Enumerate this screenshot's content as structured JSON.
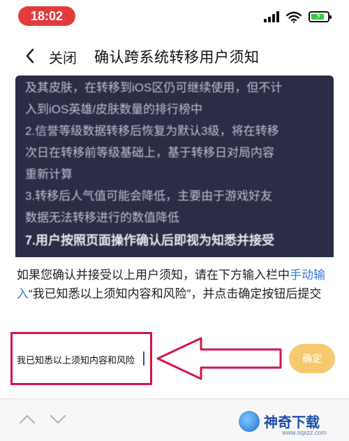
{
  "status_bar": {
    "time": "18:02",
    "time_pill_color": "#e23b3b",
    "icons": [
      "signal-icon",
      "wifi-icon",
      "battery-charging-icon"
    ]
  },
  "nav": {
    "back_icon": "chevron-left-icon",
    "close_label": "关闭",
    "title": "确认跨系统转移用户须知"
  },
  "notice": {
    "lines": [
      "及其皮肤，在转移到iOS区仍可继续使用，但不计",
      "入到iOS英雄/皮肤数量的排行榜中",
      "2.信誉等级数据转移后恢复为默认3级，将在转移",
      "次日在转移前等级基础上，基于转移日对局内容",
      "重新计算",
      "3.转移后人气值可能会降低，主要由于游戏好友",
      "数据无法转移进行的数值降低"
    ],
    "heading": "7.用户按照页面操作确认后即视为知悉并接受"
  },
  "sheet": {
    "instruction_before": "如果您确认并接受以上用户须知，请在下方输入栏中",
    "instruction_link": "手动输入",
    "instruction_after": "“我已知悉以上须知内容和风险”，并点击确定按钮后提交",
    "input_value": "我已知悉以上须知内容和风险",
    "confirm_label": "确定",
    "accent_color": "#f5c560",
    "highlight_color": "#d4144a"
  },
  "keyboard_bar": {
    "icons": [
      "chevron-up-icon",
      "chevron-down-icon"
    ]
  },
  "watermark": {
    "title": "神奇下载",
    "url": "www.sqxzz.com"
  }
}
